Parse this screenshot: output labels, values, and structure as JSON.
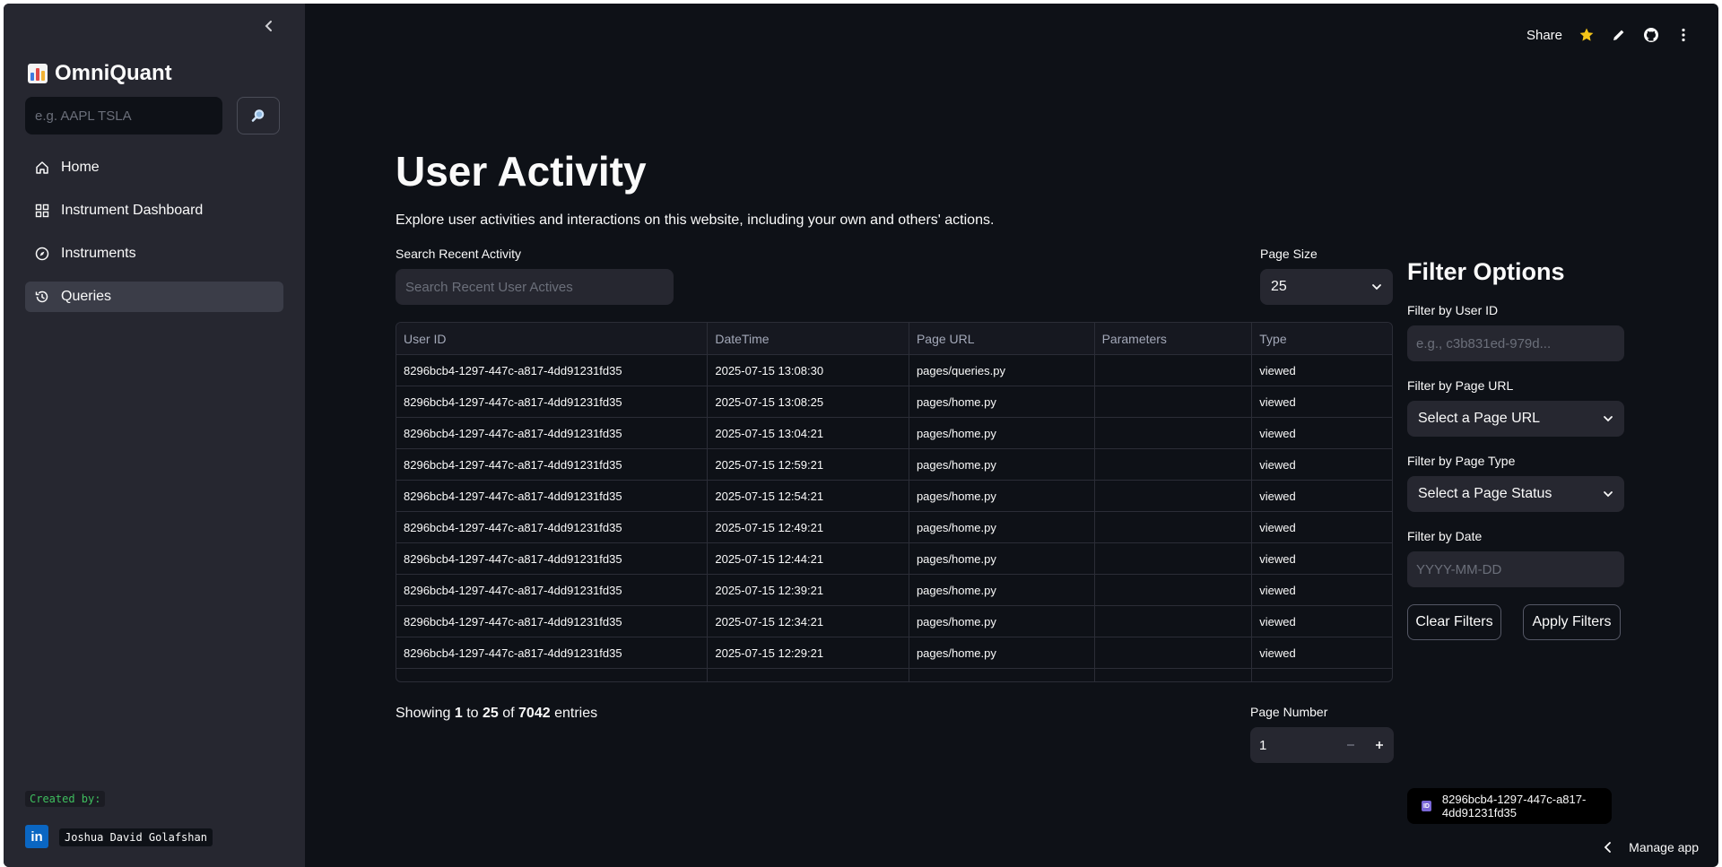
{
  "sidebar": {
    "brand_title": "OmniQuant",
    "ticker_placeholder": "e.g. AAPL TSLA",
    "nav": [
      {
        "label": "Home",
        "icon": "home-icon"
      },
      {
        "label": "Instrument Dashboard",
        "icon": "dashboard-icon"
      },
      {
        "label": "Instruments",
        "icon": "compass-icon"
      },
      {
        "label": "Queries",
        "icon": "history-icon",
        "active": true
      }
    ],
    "created_by_label": "Created by:",
    "author": "Joshua David Golafshan",
    "linkedin_glyph": "in"
  },
  "toolbar": {
    "share_label": "Share"
  },
  "main": {
    "title": "User Activity",
    "subtitle": "Explore user activities and interactions on this website, including your own and others' actions.",
    "search_label": "Search Recent Activity",
    "search_placeholder": "Search Recent User Actives",
    "page_size_label": "Page Size",
    "page_size_value": "25",
    "table": {
      "columns": [
        "User ID",
        "DateTime",
        "Page URL",
        "Parameters",
        "Type"
      ],
      "rows": [
        [
          "8296bcb4-1297-447c-a817-4dd91231fd35",
          "2025-07-15 13:08:30",
          "pages/queries.py",
          "",
          "viewed"
        ],
        [
          "8296bcb4-1297-447c-a817-4dd91231fd35",
          "2025-07-15 13:08:25",
          "pages/home.py",
          "",
          "viewed"
        ],
        [
          "8296bcb4-1297-447c-a817-4dd91231fd35",
          "2025-07-15 13:04:21",
          "pages/home.py",
          "",
          "viewed"
        ],
        [
          "8296bcb4-1297-447c-a817-4dd91231fd35",
          "2025-07-15 12:59:21",
          "pages/home.py",
          "",
          "viewed"
        ],
        [
          "8296bcb4-1297-447c-a817-4dd91231fd35",
          "2025-07-15 12:54:21",
          "pages/home.py",
          "",
          "viewed"
        ],
        [
          "8296bcb4-1297-447c-a817-4dd91231fd35",
          "2025-07-15 12:49:21",
          "pages/home.py",
          "",
          "viewed"
        ],
        [
          "8296bcb4-1297-447c-a817-4dd91231fd35",
          "2025-07-15 12:44:21",
          "pages/home.py",
          "",
          "viewed"
        ],
        [
          "8296bcb4-1297-447c-a817-4dd91231fd35",
          "2025-07-15 12:39:21",
          "pages/home.py",
          "",
          "viewed"
        ],
        [
          "8296bcb4-1297-447c-a817-4dd91231fd35",
          "2025-07-15 12:34:21",
          "pages/home.py",
          "",
          "viewed"
        ],
        [
          "8296bcb4-1297-447c-a817-4dd91231fd35",
          "2025-07-15 12:29:21",
          "pages/home.py",
          "",
          "viewed"
        ]
      ]
    },
    "showing": {
      "prefix": "Showing",
      "from": "1",
      "to_word": "to",
      "to": "25",
      "of_word": "of",
      "total": "7042",
      "suffix": "entries"
    },
    "page_number_label": "Page Number",
    "page_number_value": "1"
  },
  "filters": {
    "title": "Filter Options",
    "user_id_label": "Filter by User ID",
    "user_id_placeholder": "e.g., c3b831ed-979d...",
    "page_url_label": "Filter by Page URL",
    "page_url_value": "Select a Page URL",
    "page_type_label": "Filter by Page Type",
    "page_type_value": "Select a Page Status",
    "date_label": "Filter by Date",
    "date_placeholder": "YYYY-MM-DD",
    "clear_label": "Clear Filters",
    "apply_label": "Apply Filters"
  },
  "session": {
    "id_badge_glyph": "ID",
    "user_id": "8296bcb4-1297-447c-a817-4dd91231fd35"
  },
  "footer": {
    "manage_label": "Manage app"
  },
  "colors": {
    "background": "#0e1117",
    "sidebar": "#262730",
    "star": "#f5c518",
    "linkedin": "#0a66c2",
    "created_label": "#3fbf5f"
  }
}
